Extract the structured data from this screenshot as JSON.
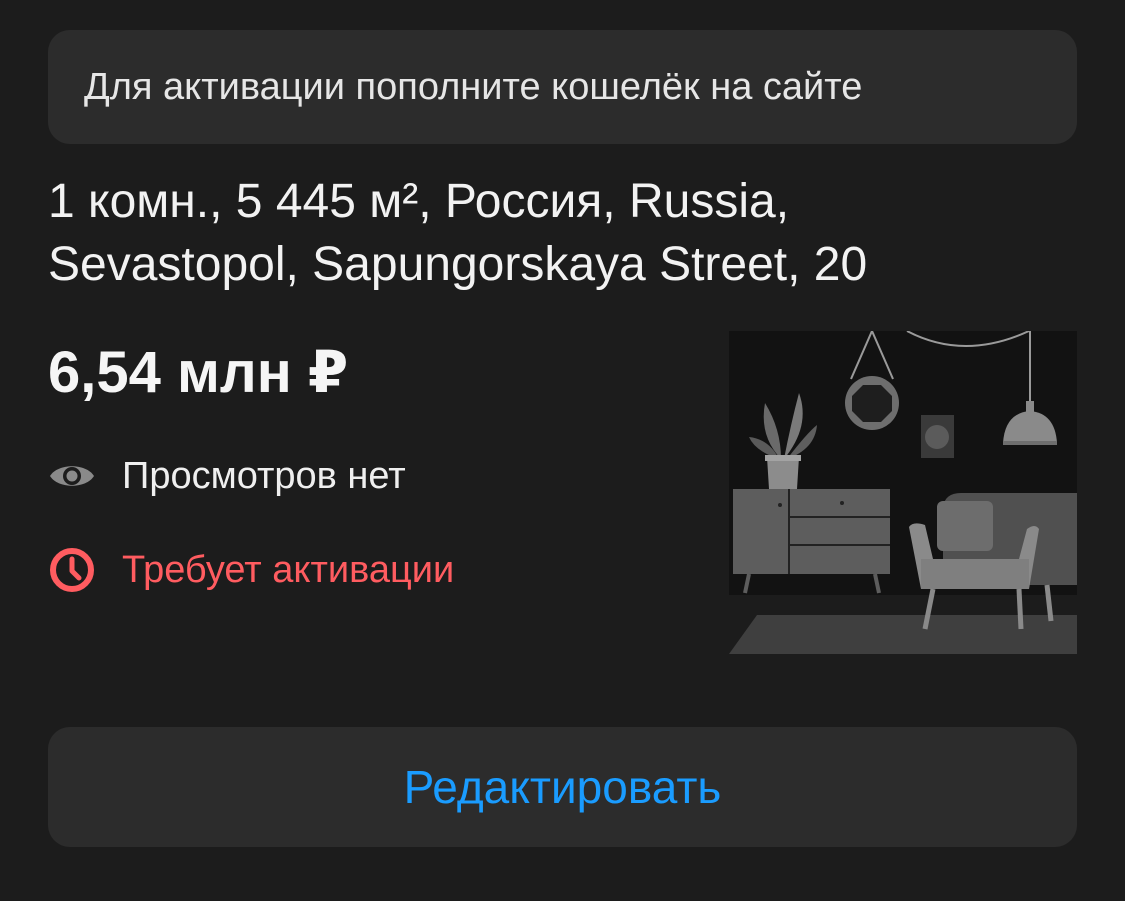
{
  "notice": {
    "text": "Для активации пополните кошелёк на сайте"
  },
  "listing": {
    "title": "1 комн., 5 445 м², Россия, Russia, Sevastopol, Sapungorskaya Street, 20",
    "price": "6,54 млн ₽",
    "views_text": "Просмотров нет",
    "status_text": "Требует активации"
  },
  "icons": {
    "views": "eye-icon",
    "status": "clock-icon",
    "photo": "room-placeholder-illustration"
  },
  "actions": {
    "edit_label": "Редактировать"
  },
  "colors": {
    "background": "#1c1c1c",
    "card": "#2c2c2c",
    "status": "#ff5c60",
    "link": "#1a9cff",
    "icon": "#8a8a8a"
  }
}
